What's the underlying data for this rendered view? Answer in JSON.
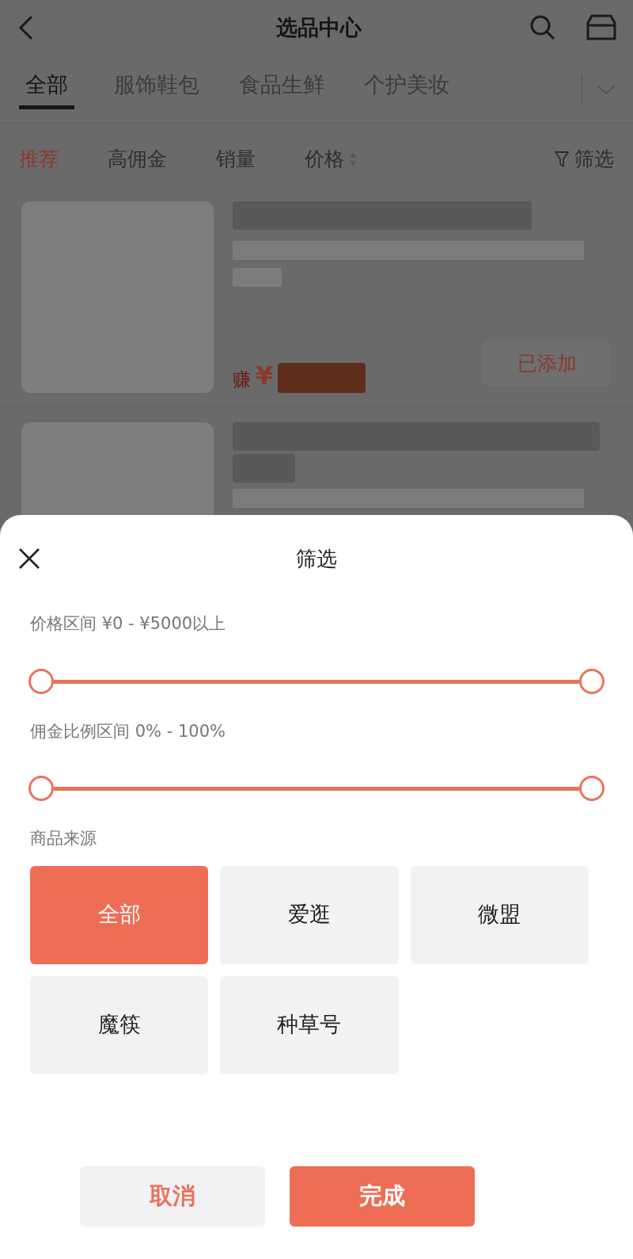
{
  "header": {
    "title": "选品中心"
  },
  "tabs": [
    {
      "label": "全部",
      "selected": true
    },
    {
      "label": "服饰鞋包",
      "selected": false
    },
    {
      "label": "食品生鲜",
      "selected": false
    },
    {
      "label": "个护美妆",
      "selected": false
    }
  ],
  "sort_options": [
    {
      "label": "推荐",
      "selected": true,
      "kind": "plain"
    },
    {
      "label": "高佣金",
      "selected": false,
      "kind": "plain"
    },
    {
      "label": "销量",
      "selected": false,
      "kind": "plain"
    },
    {
      "label": "价格",
      "selected": false,
      "kind": "sortable"
    }
  ],
  "filter_button": {
    "label": "筛选"
  },
  "products": [
    {
      "earn_label": "赚",
      "currency": "¥",
      "button": "已添加"
    }
  ],
  "filter_sheet": {
    "title": "筛选",
    "price_range": {
      "label": "价格区间 ¥0 - ¥5000以上",
      "thumbs": [
        {
          "level": 0
        },
        {
          "level": 1
        }
      ]
    },
    "commission_range": {
      "label": "佣金比例区间 0% - 100%",
      "thumbs": [
        {
          "level": 0
        },
        {
          "level": 1
        }
      ]
    },
    "source": {
      "label": "商品来源",
      "options": [
        {
          "label": "全部",
          "selected": true
        },
        {
          "label": "爱逛",
          "selected": false
        },
        {
          "label": "微盟",
          "selected": false
        },
        {
          "label": "魔筷",
          "selected": false
        },
        {
          "label": "种草号",
          "selected": false
        }
      ]
    },
    "buttons": [
      {
        "label": "取消",
        "kind": "secondary"
      },
      {
        "label": "完成",
        "kind": "primary"
      }
    ]
  }
}
